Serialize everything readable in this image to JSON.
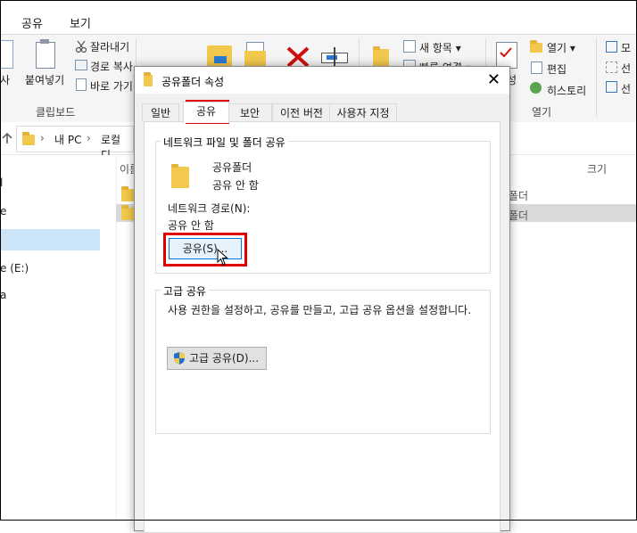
{
  "ribbon": {
    "tabs": [
      "공유",
      "보기"
    ],
    "clipboard": {
      "paste_label": "붙여넣기",
      "paste_partial": "사",
      "cut_label": "잘라내기",
      "copy_path_label": "경로 복사",
      "paste_shortcut_label": "바로 가기",
      "group_label": "클립보드"
    },
    "new": {
      "new_item_label": "새 항목 ▾",
      "easy_access_label": "빠른 연결 ▾"
    },
    "open": {
      "open_label": "열기 ▾",
      "edit_label": "편집",
      "history_label": "히스토리",
      "properties_partial": "성",
      "group_label": "열기"
    },
    "select": {
      "select_all_partial": "모",
      "select_none_partial": "선",
      "invert_partial": "선"
    }
  },
  "address": {
    "crumbs": [
      "내 PC",
      "로컬 디"
    ]
  },
  "nav_pane": {
    "items_partial": [
      "l",
      "e",
      "",
      "e (E:)",
      "a"
    ]
  },
  "list": {
    "column_name_partial": "이름",
    "column_size": "크기",
    "rows": [
      {
        "type_partial": "폴더"
      },
      {
        "type_partial": "폴더"
      }
    ]
  },
  "dialog": {
    "title": "공유폴더 속성",
    "close_glyph": "✕",
    "tabs": [
      "일반",
      "공유",
      "보안",
      "이전 버전",
      "사용자 지정"
    ],
    "network_sharing": {
      "group_title": "네트워크 파일 및 폴더 공유",
      "folder_name": "공유폴더",
      "folder_status": "공유 안 함",
      "path_label": "네트워크 경로(N):",
      "path_value": "공유 안 함",
      "share_button": "공유(S)..."
    },
    "advanced_sharing": {
      "group_title": "고급 공유",
      "description": "사용 권한을 설정하고, 공유를 만들고, 고급 공유 옵션을 설정합니다.",
      "button": "고급 공유(D)..."
    }
  },
  "colors": {
    "highlight_red": "#e00000",
    "folder_yellow": "#f2c94c",
    "selection_blue": "#cce4f7"
  }
}
